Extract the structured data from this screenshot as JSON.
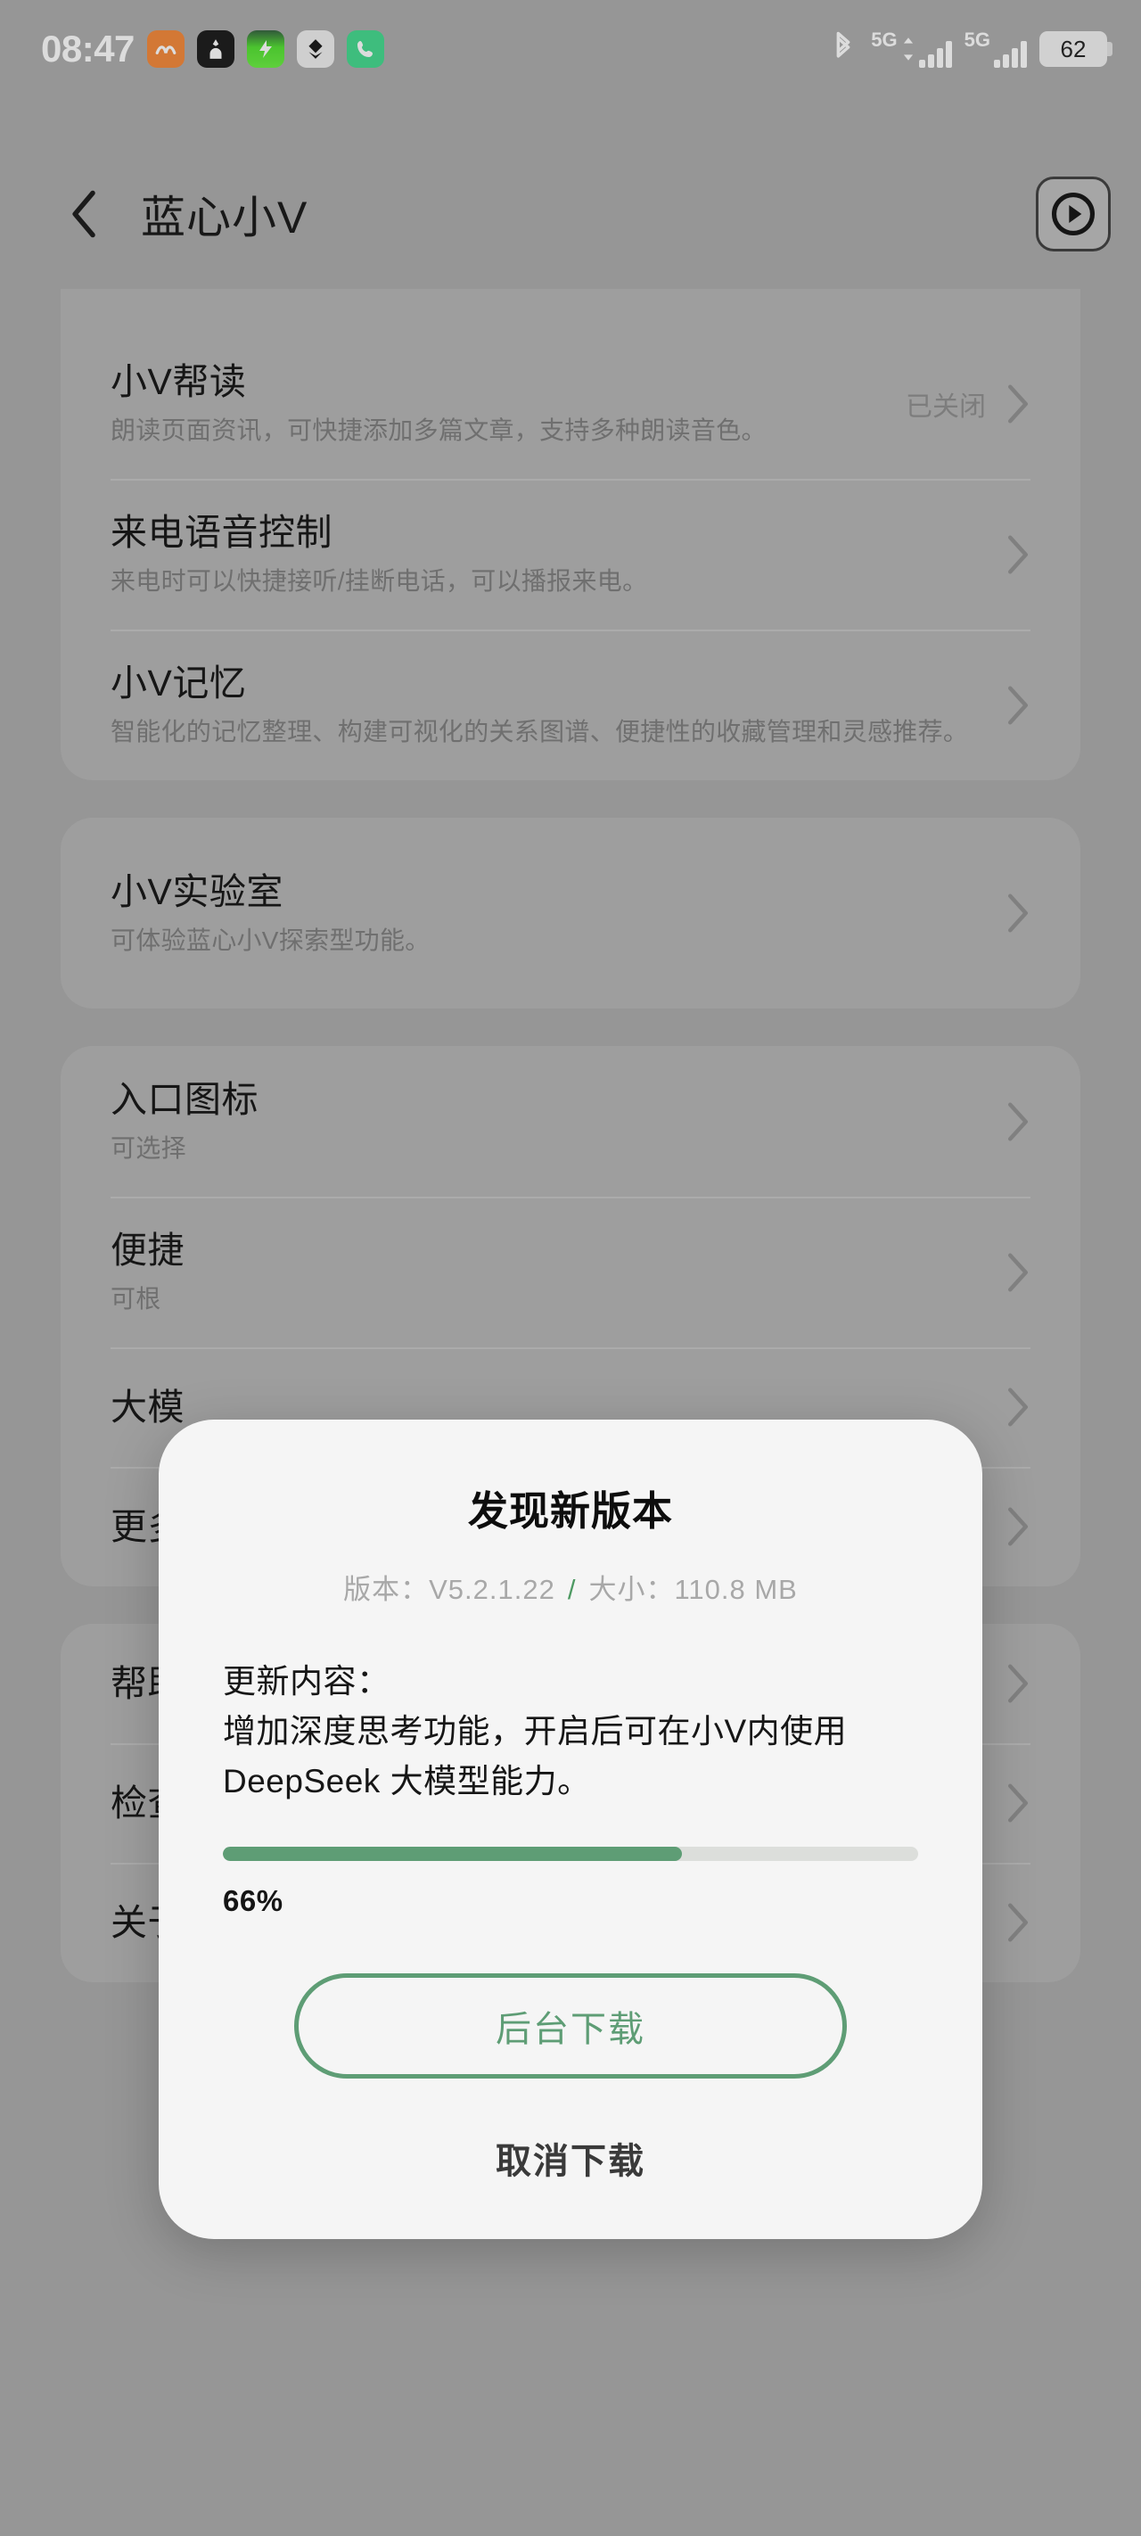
{
  "status_bar": {
    "time": "08:47",
    "battery_level": "62",
    "network_labels": [
      "5G",
      "5G"
    ],
    "icons": [
      {
        "name": "bluetooth-icon"
      },
      {
        "name": "signal-bars-icon"
      },
      {
        "name": "battery-icon"
      }
    ],
    "notification_icons": [
      {
        "name": "music-app-icon",
        "glyph": "〜"
      },
      {
        "name": "security-app-icon",
        "glyph": "♟"
      },
      {
        "name": "charging-app-icon",
        "glyph": "⚡"
      },
      {
        "name": "download-app-icon",
        "glyph": "▼"
      },
      {
        "name": "phone-app-icon",
        "glyph": "☎"
      }
    ]
  },
  "header": {
    "title": "蓝心小V",
    "back_label": "返回",
    "play_button_label": "播放"
  },
  "sections": [
    {
      "id": "card-top",
      "rows": [
        {
          "title": "小V帮读",
          "desc": "朗读页面资讯，可快捷添加多篇文章，支持多种朗读音色。",
          "status": "已关闭"
        },
        {
          "title": "来电语音控制",
          "desc": "来电时可以快捷接听/挂断电话，可以播报来电。",
          "status": ""
        },
        {
          "title": "小V记忆",
          "desc": "智能化的记忆整理、构建可视化的关系图谱、便捷性的收藏管理和灵感推荐。",
          "status": ""
        }
      ]
    },
    {
      "id": "card-lab",
      "rows": [
        {
          "title": "小V实验室",
          "desc": "可体验蓝心小V探索型功能。",
          "status": ""
        }
      ]
    },
    {
      "id": "card-settings",
      "rows": [
        {
          "title": "入口图标",
          "desc": "可选择",
          "status": ""
        },
        {
          "title": "便捷",
          "desc": "可根",
          "status": ""
        },
        {
          "title": "大模",
          "desc": "",
          "status": ""
        },
        {
          "title": "更多",
          "desc": "",
          "status": ""
        }
      ]
    },
    {
      "id": "card-about",
      "rows": [
        {
          "title": "帮助",
          "desc": "",
          "status": ""
        },
        {
          "title": "检查",
          "desc": "",
          "status": ""
        },
        {
          "title": "关于",
          "desc": "",
          "status": ""
        }
      ]
    }
  ],
  "dialog": {
    "title": "发现新版本",
    "version_label": "版本：",
    "version_value": "V5.2.1.22",
    "separator": "/",
    "size_label": "大小：",
    "size_value": "110.8 MB",
    "content_heading": "更新内容：",
    "content_body": "增加深度思考功能，开启后可在小V内使用 DeepSeek 大模型能力。",
    "progress_percent": 66,
    "progress_label": "66%",
    "primary_button": "后台下载",
    "secondary_button": "取消下载",
    "accent_color": "#5e9d75"
  }
}
